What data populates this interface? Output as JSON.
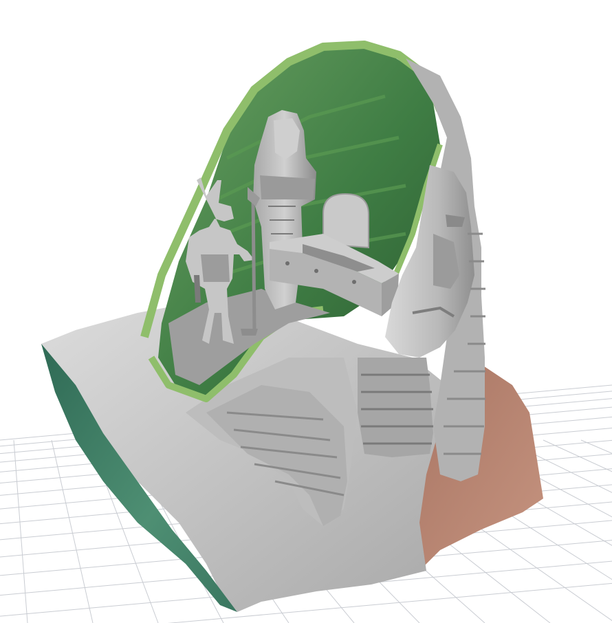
{
  "viewport": {
    "background": "#ffffff",
    "grid_color": "#c9ccd2"
  },
  "model": {
    "colors": {
      "body_gray": "#c4c4c4",
      "shadow_gray": "#8e8e8e",
      "highlight_gray": "#e6e6e6",
      "cavity_green": "#4f8a4e",
      "cavity_green_dark": "#2f6533",
      "rim_green": "#8fbe6b",
      "left_face_teal": "#3f7a63",
      "back_face_brown": "#b8836c"
    }
  }
}
